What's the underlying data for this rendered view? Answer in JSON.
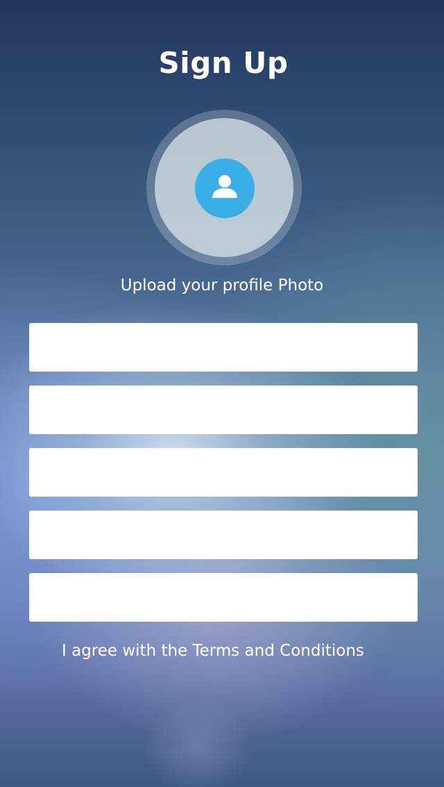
{
  "header": {
    "title": "Sign Up"
  },
  "profile_photo": {
    "icon": "user-icon",
    "icon_color": "#3aaee6",
    "upload_label": "Upload your profile Photo"
  },
  "form": {
    "fields": [
      {
        "value": "",
        "placeholder": ""
      },
      {
        "value": "",
        "placeholder": ""
      },
      {
        "value": "",
        "placeholder": ""
      },
      {
        "value": "",
        "placeholder": ""
      },
      {
        "value": "",
        "placeholder": ""
      }
    ]
  },
  "terms": {
    "label": "I agree with the Terms and Conditions"
  }
}
